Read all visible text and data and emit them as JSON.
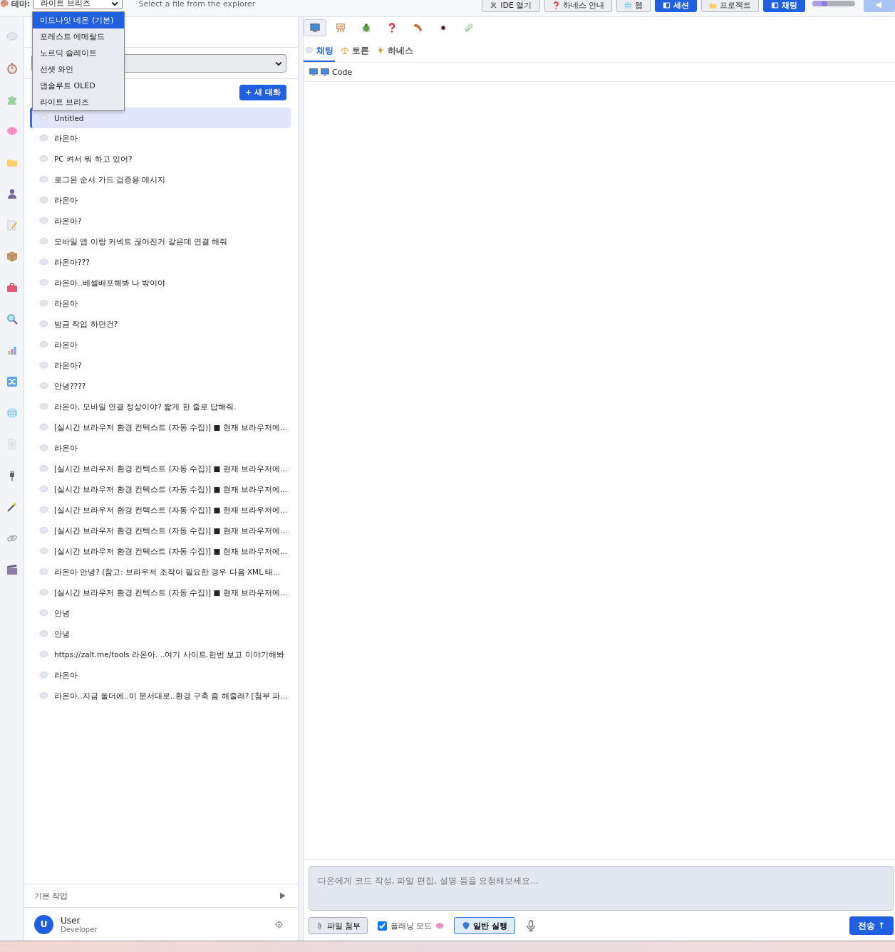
{
  "header": {
    "theme_label": "테마:",
    "theme_value": "라이트 브리즈",
    "file_hint": "Select a file from the explorer",
    "buttons": [
      {
        "label": "IDE 열기",
        "kind": "default"
      },
      {
        "label": "하네스 안내",
        "kind": "default"
      },
      {
        "label": "웹",
        "kind": "default"
      },
      {
        "label": "세션",
        "kind": "primary"
      },
      {
        "label": "프로젝트",
        "kind": "default"
      },
      {
        "label": "채팅",
        "kind": "primary"
      }
    ],
    "slider": {
      "level": 0.35
    },
    "end_button": {
      "disabled": true
    }
  },
  "theme_menu": [
    {
      "label": "미드나잇 네온 (기본)",
      "highlighted": true
    },
    {
      "label": "포레스트 에메랄드",
      "highlighted": false
    },
    {
      "label": "노르딕 슬레이트",
      "highlighted": false
    },
    {
      "label": "선셋 와인",
      "highlighted": false
    },
    {
      "label": "앱솔루트 OLED",
      "highlighted": false
    },
    {
      "label": "라이트 브리즈",
      "highlighted": false
    }
  ],
  "sidebar": {
    "new_chat": "+ 새 대화",
    "conversations": [
      {
        "title": "Untitled",
        "selected": true
      },
      {
        "title": "라온아",
        "selected": false
      },
      {
        "title": "PC 켜서 뭐 하고 있어?",
        "selected": false
      },
      {
        "title": "로그온 순서 가드 검증용 메시지",
        "selected": false
      },
      {
        "title": "라온아",
        "selected": false
      },
      {
        "title": "라온아?",
        "selected": false
      },
      {
        "title": "모바일 앱 이랑 커넥트 끊어진거 같은데 연결 해줘",
        "selected": false
      },
      {
        "title": "라온아???",
        "selected": false
      },
      {
        "title": "라온아..베셀배포해봐 나 밖이야",
        "selected": false
      },
      {
        "title": "라온아",
        "selected": false
      },
      {
        "title": "방금 작업 하던건?",
        "selected": false
      },
      {
        "title": "라온아",
        "selected": false
      },
      {
        "title": "라온아?",
        "selected": false
      },
      {
        "title": "안녕????",
        "selected": false
      },
      {
        "title": "라온아, 모바일 연결 정상이야? 짧게 한 줄로 답해줘.",
        "selected": false
      },
      {
        "title": "[실시간 브라우저 환경 컨텍스트 (자동 수집)] ■ 현재 브라우저에...",
        "selected": false
      },
      {
        "title": "라온아",
        "selected": false
      },
      {
        "title": "[실시간 브라우저 환경 컨텍스트 (자동 수집)] ■ 현재 브라우저에...",
        "selected": false
      },
      {
        "title": "[실시간 브라우저 환경 컨텍스트 (자동 수집)] ■ 현재 브라우저에...",
        "selected": false
      },
      {
        "title": "[실시간 브라우저 환경 컨텍스트 (자동 수집)] ■ 현재 브라우저에...",
        "selected": false
      },
      {
        "title": "[실시간 브라우저 환경 컨텍스트 (자동 수집)] ■ 현재 브라우저에...",
        "selected": false
      },
      {
        "title": "[실시간 브라우저 환경 컨텍스트 (자동 수집)] ■ 현재 브라우저에...",
        "selected": false
      },
      {
        "title": "라온아 안녕? (참고: 브라우저 조작이 필요한 경우 다음 XML 태...",
        "selected": false
      },
      {
        "title": "[실시간 브라우저 환경 컨텍스트 (자동 수집)] ■ 현재 브라우저에...",
        "selected": false
      },
      {
        "title": "안녕",
        "selected": false
      },
      {
        "title": "안녕",
        "selected": false
      },
      {
        "title": "https://zalt.me/tools 라온아. ..여기 사이트.한번 보고 이야기해봐",
        "selected": false
      },
      {
        "title": "라온아",
        "selected": false
      },
      {
        "title": "라온아..지금 폴더에..이 문서대로..환경 구축 좀 해줄래? [첨부 파...",
        "selected": false
      }
    ],
    "tasks": {
      "label": "기본 작업",
      "expanded": false
    },
    "user": {
      "initial": "U",
      "name": "User",
      "role": "Developer"
    }
  },
  "main": {
    "tool_tabs": [
      {
        "selected": true
      },
      {
        "selected": false
      },
      {
        "selected": false
      },
      {
        "selected": false
      },
      {
        "selected": false
      },
      {
        "selected": false
      },
      {
        "selected": false
      }
    ],
    "mode_tabs": [
      {
        "label": "채팅",
        "selected": true
      },
      {
        "label": "토론",
        "selected": false
      },
      {
        "label": "하네스",
        "selected": false
      }
    ],
    "breadcrumb": "Code",
    "composer": {
      "placeholder": "다온에게 코드 작성, 파일 편집, 설명 등을 요청해보세요...",
      "attach": "파일 첨부",
      "planning": {
        "label": "플래닝 모드",
        "checked": true
      },
      "run_mode": "일반 실행",
      "send": "전송 ↑"
    }
  }
}
